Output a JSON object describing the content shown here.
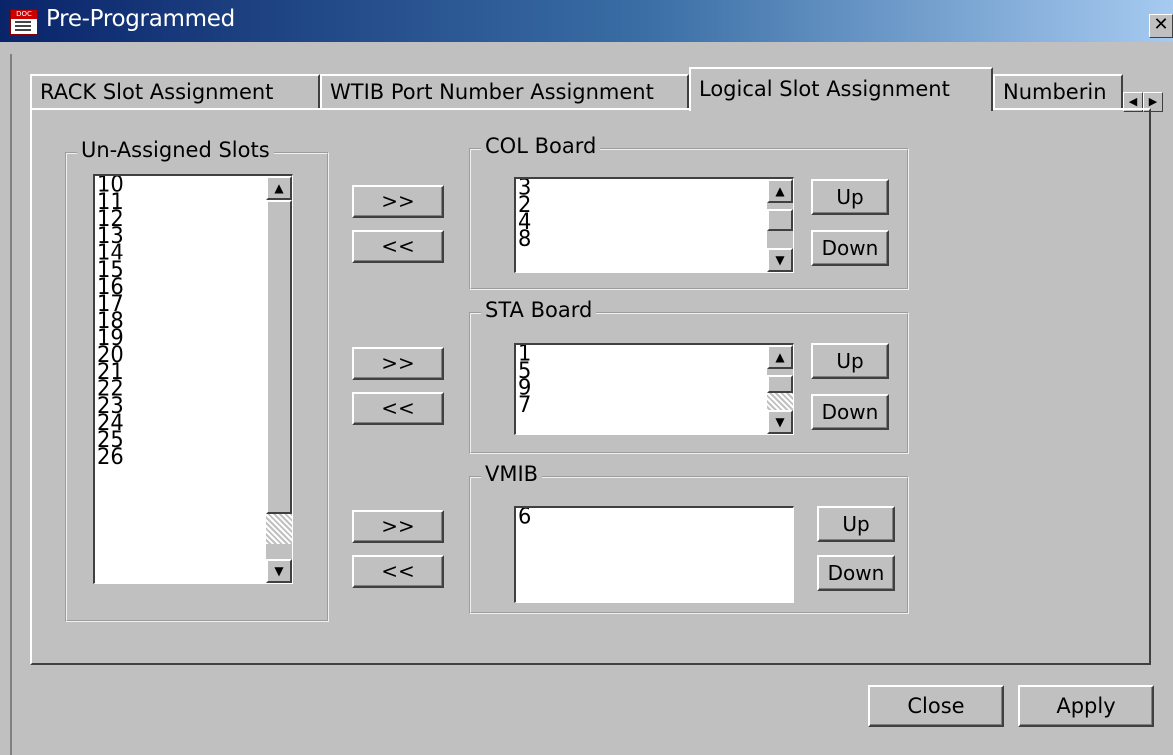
{
  "window": {
    "title": "Pre-Programmed",
    "close_glyph": "✕",
    "app_icon_label": "DOC"
  },
  "tabs": [
    {
      "label": "RACK Slot Assignment"
    },
    {
      "label": "WTIB Port Number Assignment"
    },
    {
      "label": "Logical Slot Assignment",
      "active": true
    },
    {
      "label": "Numberin"
    }
  ],
  "tab_scroll": {
    "left": "◀",
    "right": "▶"
  },
  "unassigned": {
    "legend": "Un-Assigned Slots",
    "items": [
      "10",
      "11",
      "12",
      "13",
      "14",
      "15",
      "16",
      "17",
      "18",
      "19",
      "20",
      "21",
      "22",
      "23",
      "24",
      "25",
      "26"
    ]
  },
  "col_board": {
    "legend": "COL Board",
    "items": [
      "3",
      "2",
      "4",
      "8"
    ]
  },
  "sta_board": {
    "legend": "STA Board",
    "items": [
      "1",
      "5",
      "9",
      "7"
    ]
  },
  "vmib": {
    "legend": "VMIB",
    "items": [
      "6"
    ]
  },
  "buttons": {
    "move_right": ">>",
    "move_left": "<<",
    "up": "Up",
    "down": "Down",
    "close": "Close",
    "apply": "Apply"
  },
  "scroll_glyphs": {
    "up": "▲",
    "down": "▼"
  }
}
